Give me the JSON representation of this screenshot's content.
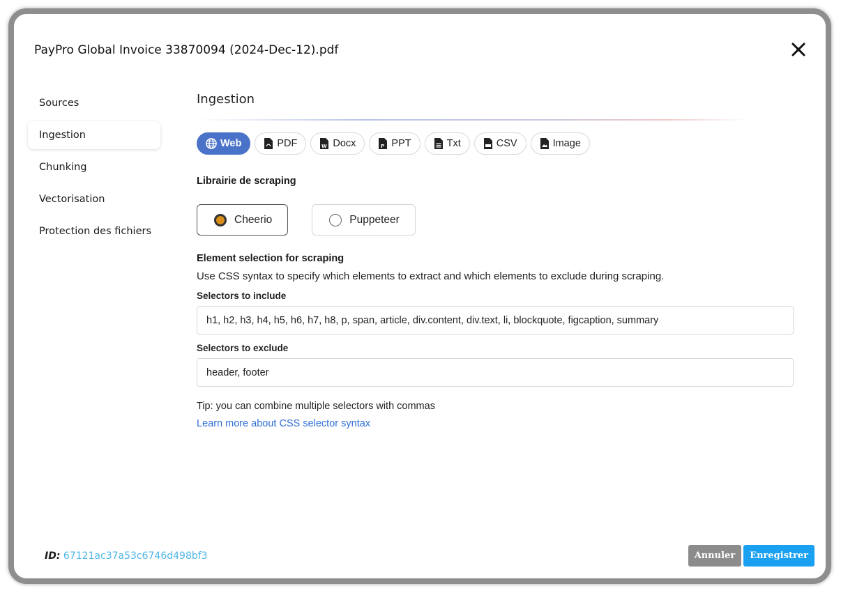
{
  "dialog": {
    "title": "PayPro Global Invoice 33870094 (2024-Dec-12).pdf"
  },
  "sidebar": {
    "items": [
      {
        "label": "Sources",
        "active": false
      },
      {
        "label": "Ingestion",
        "active": true
      },
      {
        "label": "Chunking",
        "active": false
      },
      {
        "label": "Vectorisation",
        "active": false
      },
      {
        "label": "Protection des fichiers",
        "active": false
      }
    ]
  },
  "main": {
    "section_title": "Ingestion",
    "tabs": [
      {
        "label": "Web",
        "icon": "globe-icon",
        "active": true
      },
      {
        "label": "PDF",
        "icon": "pdf-file-icon",
        "active": false
      },
      {
        "label": "Docx",
        "icon": "docx-file-icon",
        "active": false
      },
      {
        "label": "PPT",
        "icon": "ppt-file-icon",
        "active": false
      },
      {
        "label": "Txt",
        "icon": "txt-file-icon",
        "active": false
      },
      {
        "label": "CSV",
        "icon": "csv-file-icon",
        "active": false
      },
      {
        "label": "Image",
        "icon": "image-file-icon",
        "active": false
      }
    ],
    "library_label": "Librairie de scraping",
    "library_options": [
      {
        "label": "Cheerio",
        "selected": true
      },
      {
        "label": "Puppeteer",
        "selected": false
      }
    ],
    "element_selection_title": "Element selection for scraping",
    "element_selection_desc": "Use CSS syntax to specify which elements to extract and which elements to exclude during scraping.",
    "include_label": "Selectors to include",
    "include_value": "h1, h2, h3, h4, h5, h6, h7, h8, p, span, article, div.content, div.text, li, blockquote, figcaption, summary",
    "exclude_label": "Selectors to exclude",
    "exclude_value": "header, footer",
    "tip": "Tip: you can combine multiple selectors with commas",
    "learn_more": "Learn more about CSS selector syntax"
  },
  "footer": {
    "id_label": "ID:",
    "id_value": "67121ac37a53c6746d498bf3",
    "cancel_label": "Annuler",
    "save_label": "Enregistrer"
  },
  "colors": {
    "accent_tab": "#4a72c8",
    "radio_selected": "#d98e1c",
    "link": "#2e6fd6",
    "id_value": "#4fb6e6",
    "save_button": "#1aa0f0",
    "cancel_button": "#8c8c8c"
  }
}
